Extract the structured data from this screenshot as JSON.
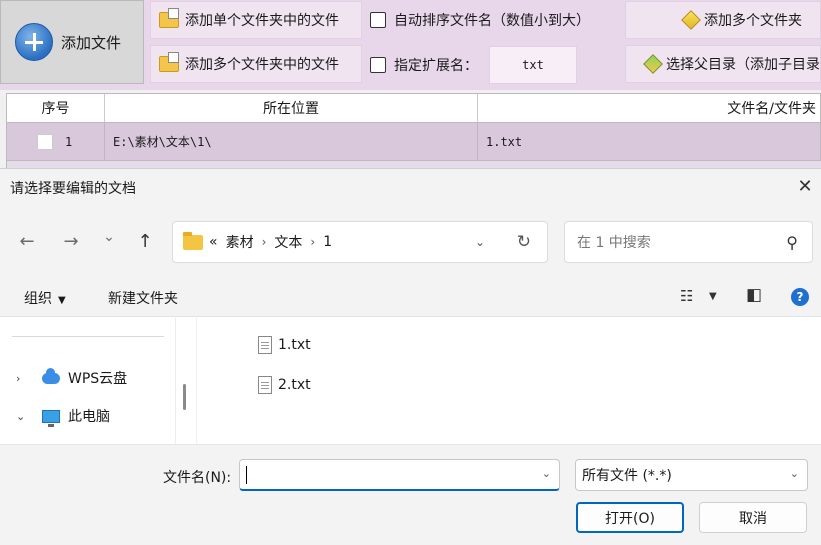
{
  "app": {
    "add_file_label": "添加文件",
    "add_single_folder_label": "添加单个文件夹中的文件",
    "add_multi_folder_label": "添加多个文件夹中的文件",
    "auto_sort_label": "自动排序文件名（数值小到大）",
    "ext_label": "指定扩展名：",
    "ext_value": "txt",
    "add_multi_folders_label": "添加多个文件夹",
    "choose_parent_label": "选择父目录（添加子目录",
    "table": {
      "headers": [
        "序号",
        "所在位置",
        "文件名/文件夹"
      ],
      "rows": [
        {
          "index": "1",
          "location": "E:\\素材\\文本\\1\\",
          "filename": "1.txt"
        }
      ]
    }
  },
  "dialog": {
    "title": "请选择要编辑的文档",
    "close_glyph": "✕",
    "nav": {
      "back": "←",
      "forward": "→",
      "recent": "⌄",
      "up": "↑",
      "overflow": "«",
      "path": [
        "素材",
        "文本",
        "1"
      ],
      "path_sep": "›",
      "dropdown": "⌄",
      "refresh": "↻",
      "search_placeholder": "在 1 中搜索",
      "search_icon": "⚲"
    },
    "commands": {
      "organize": "组织",
      "organize_caret": "▼",
      "new_folder": "新建文件夹",
      "view_icon": "☷",
      "view_caret": "▼",
      "pane_icon": "◧",
      "help": "?"
    },
    "navpane": {
      "items": [
        {
          "chevron": "›",
          "label": "WPS云盘"
        },
        {
          "chevron": "⌄",
          "label": "此电脑"
        }
      ]
    },
    "files": [
      "1.txt",
      "2.txt"
    ],
    "footer": {
      "filename_label": "文件名(N):",
      "filename_value": "",
      "filetype_value": "所有文件 (*.*)",
      "dropdown": "⌄",
      "open_label": "打开(O)",
      "cancel_label": "取消"
    }
  }
}
